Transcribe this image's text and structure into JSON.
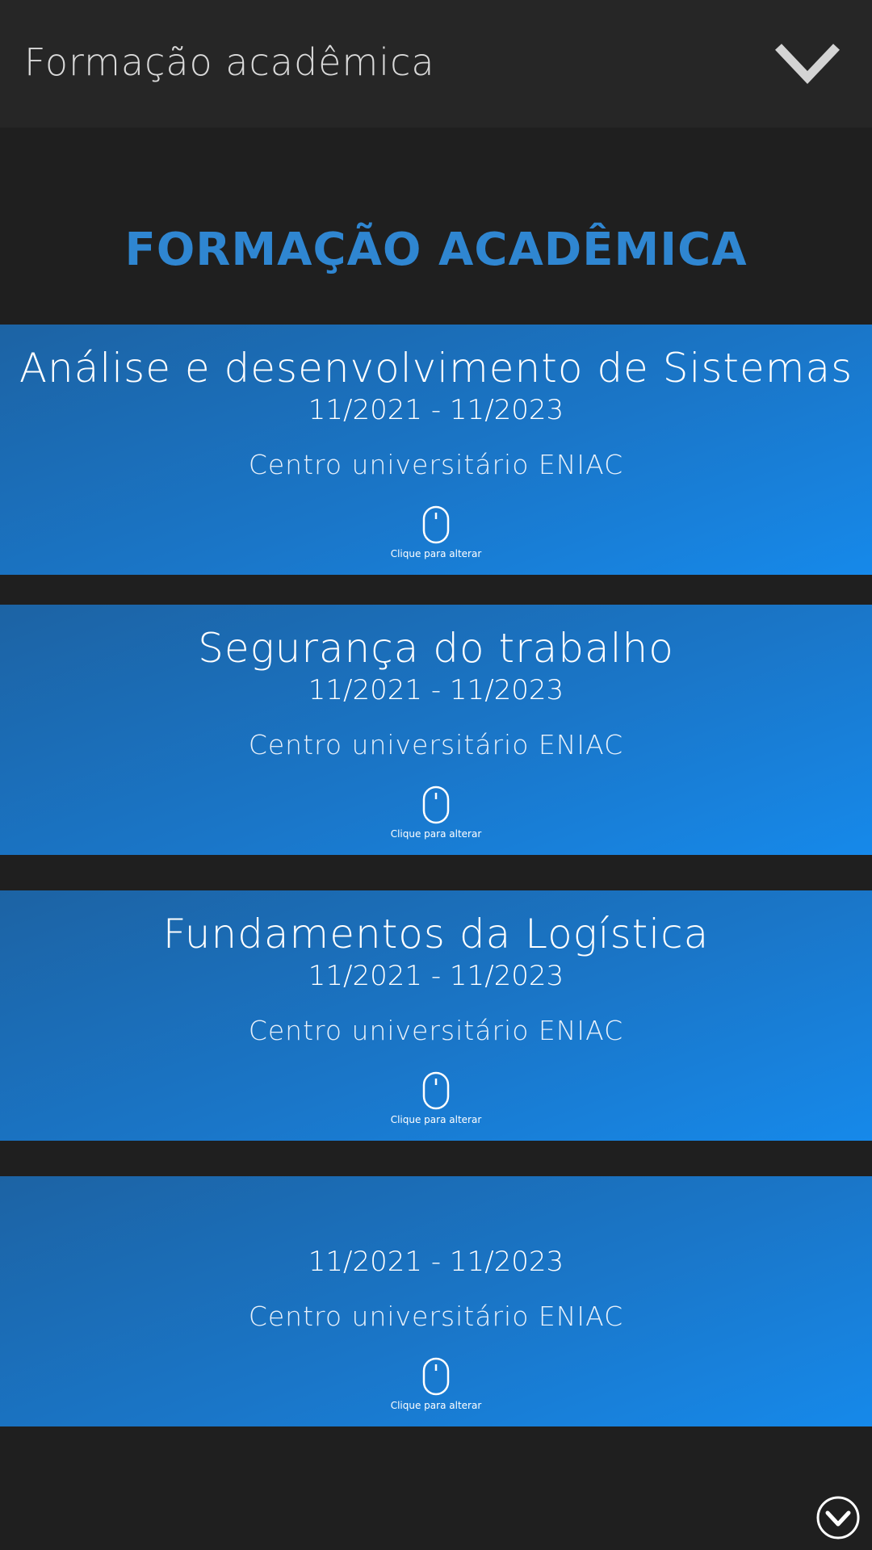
{
  "header": {
    "title": "Formação acadêmica",
    "toggle_icon": "chevron-down-icon"
  },
  "section": {
    "title": "FORMAÇÃO ACADÊMICA"
  },
  "colors": {
    "background": "#1f1f1f",
    "header": "#262626",
    "accent": "#2f86d1",
    "card_gradient": [
      "#1c63a4",
      "#1689ea"
    ]
  },
  "cards": [
    {
      "title": "Análise e desenvolvimento de Sistemas",
      "dates": "11/2021 -  11/2023",
      "school": "Centro universitário ENIAC",
      "hint": "Clique para alterar",
      "icon": "mouse-icon"
    },
    {
      "title": "Segurança do trabalho",
      "dates": "11/2021 -  11/2023",
      "school": "Centro universitário ENIAC",
      "hint": "Clique para alterar",
      "icon": "mouse-icon"
    },
    {
      "title": "Fundamentos da Logística",
      "dates": "11/2021 -  11/2023",
      "school": "Centro universitário ENIAC",
      "hint": "Clique para alterar",
      "icon": "mouse-icon"
    },
    {
      "title": "",
      "dates": "11/2021 -  11/2023",
      "school": "Centro universitário ENIAC",
      "hint": "Clique para alterar",
      "icon": "mouse-icon"
    }
  ],
  "footer": {
    "scroll_icon": "circle-chevron-down-icon"
  }
}
